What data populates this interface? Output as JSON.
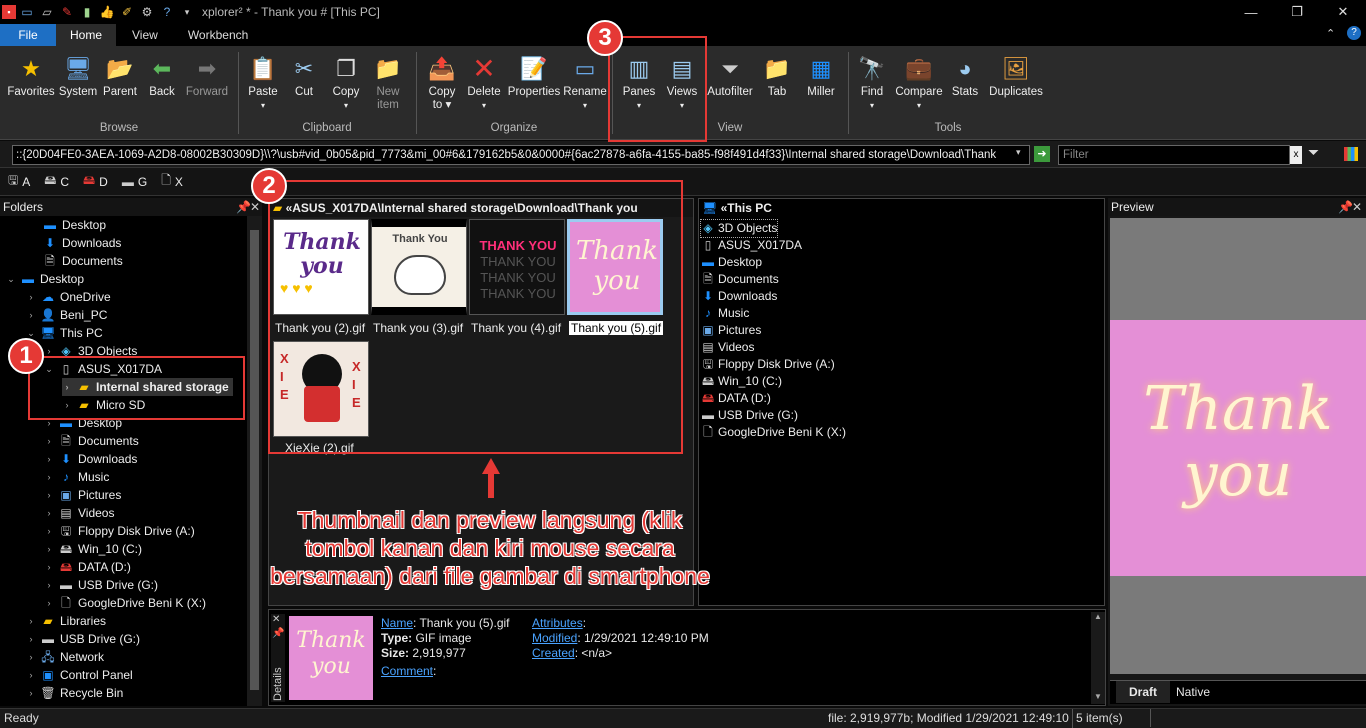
{
  "window": {
    "title": "xplorer² * - Thank you # [This PC]"
  },
  "tabs": [
    {
      "label": "File"
    },
    {
      "label": "Home"
    },
    {
      "label": "View"
    },
    {
      "label": "Workbench"
    }
  ],
  "ribbon": {
    "browse": {
      "label": "Browse",
      "items": [
        "Favorites",
        "System",
        "Parent",
        "Back",
        "Forward"
      ]
    },
    "clipboard": {
      "label": "Clipboard",
      "items": [
        "Paste",
        "Cut",
        "Copy",
        "New",
        "item"
      ]
    },
    "organize": {
      "label": "Organize",
      "items": [
        "Copy",
        "to",
        "Delete",
        "Properties",
        "Rename"
      ]
    },
    "view": {
      "label": "View",
      "items": [
        "Panes",
        "Views",
        "Autofilter",
        "Tab",
        "Miller"
      ]
    },
    "tools": {
      "label": "Tools",
      "items": [
        "Find",
        "Compare",
        "Stats",
        "Duplicates"
      ]
    }
  },
  "address": {
    "value": "::{20D04FE0-3AEA-1069-A2D8-08002B30309D}\\\\?\\usb#vid_0b05&pid_7773&mi_00#6&179162b5&0&0000#{6ac27878-a6fa-4155-ba85-f98f491d4f33}\\Internal shared storage\\Download\\Thank",
    "filter_placeholder": "Filter"
  },
  "drives": [
    "A",
    "C",
    "D",
    "G",
    "X"
  ],
  "folders": {
    "header": "Folders",
    "items": [
      "Desktop",
      "Downloads",
      "Documents",
      "Desktop",
      "OneDrive",
      "Beni_PC",
      "This PC",
      "3D Objects",
      "ASUS_X017DA",
      "Internal shared storage",
      "Micro SD",
      "Desktop",
      "Documents",
      "Downloads",
      "Music",
      "Pictures",
      "Videos",
      "Floppy Disk Drive (A:)",
      "Win_10 (C:)",
      "DATA (D:)",
      "USB Drive (G:)",
      "GoogleDrive Beni K (X:)",
      "Libraries",
      "USB Drive (G:)",
      "Network",
      "Control Panel",
      "Recycle Bin"
    ]
  },
  "middle": {
    "header": "«ASUS_X017DA\\Internal shared storage\\Download\\Thank you",
    "files": [
      "Thank you (2).gif",
      "Thank you (3).gif",
      "Thank you (4).gif",
      "Thank you (5).gif",
      "XieXie (2).gif"
    ]
  },
  "right": {
    "header": "«This PC",
    "items": [
      "3D Objects",
      "ASUS_X017DA",
      "Desktop",
      "Documents",
      "Downloads",
      "Music",
      "Pictures",
      "Videos",
      "Floppy Disk Drive (A:)",
      "Win_10 (C:)",
      "DATA (D:)",
      "USB Drive (G:)",
      "GoogleDrive Beni K (X:)"
    ]
  },
  "preview": {
    "header": "Preview",
    "tabs": [
      "Draft",
      "Native"
    ]
  },
  "details": {
    "side_label": "Details",
    "name_label": "Name",
    "name_value": ": Thank you (5).gif",
    "type_label": "Type:",
    "type_value": "GIF image",
    "size_label": "Size:",
    "size_value": "2,919,977",
    "comment_label": "Comment",
    "attr_label": "Attributes",
    "modified_label": "Modified",
    "modified_value": ": 1/29/2021 12:49:10 PM",
    "created_label": "Created",
    "created_value": ": <n/a>"
  },
  "status": {
    "left": "Ready",
    "file": "file: 2,919,977b; Modified 1/29/2021 12:49:10 PM",
    "count": "5 item(s)"
  },
  "annotations": {
    "n1": "1",
    "n2": "2",
    "n3": "3",
    "caption": [
      "Thumbnail dan preview langsung (klik",
      "tombol kanan dan kiri mouse secara",
      "bersamaan) dari file gambar di smartphone"
    ]
  },
  "thumb_text": {
    "t2": "Thank you",
    "t3": "Thank You",
    "t4a": "THANK YOU",
    "t4b": "THANK YOU",
    "t5": "Thank you",
    "x": "X",
    "i": "I",
    "e": "E"
  },
  "colors": {
    "accent": "#1e6fc4",
    "annotation": "#e53935",
    "pink": "#e48fd6"
  }
}
